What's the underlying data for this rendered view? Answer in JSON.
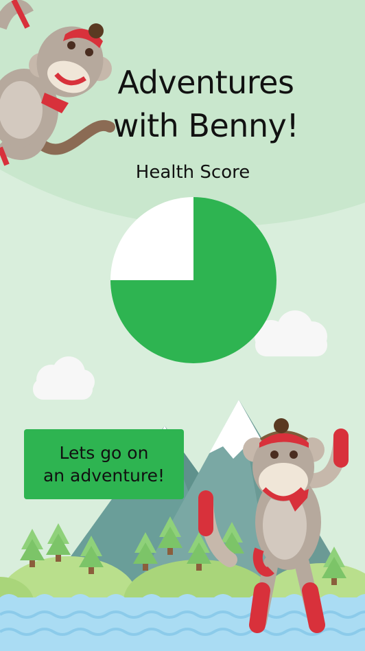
{
  "title": {
    "line1": "Adventures",
    "line2": "with Benny!"
  },
  "health": {
    "label": "Health Score",
    "score_fraction": 0.75,
    "fill_color": "#2eb451",
    "empty_color": "#ffffff"
  },
  "adventure_button": {
    "line1": "Lets go on",
    "line2": "an adventure!"
  },
  "colors": {
    "background": "#d9eedc",
    "hill": "#c9e7cd",
    "button": "#2eb451",
    "water": "#aadcf3",
    "sock_red": "#d8313b"
  }
}
